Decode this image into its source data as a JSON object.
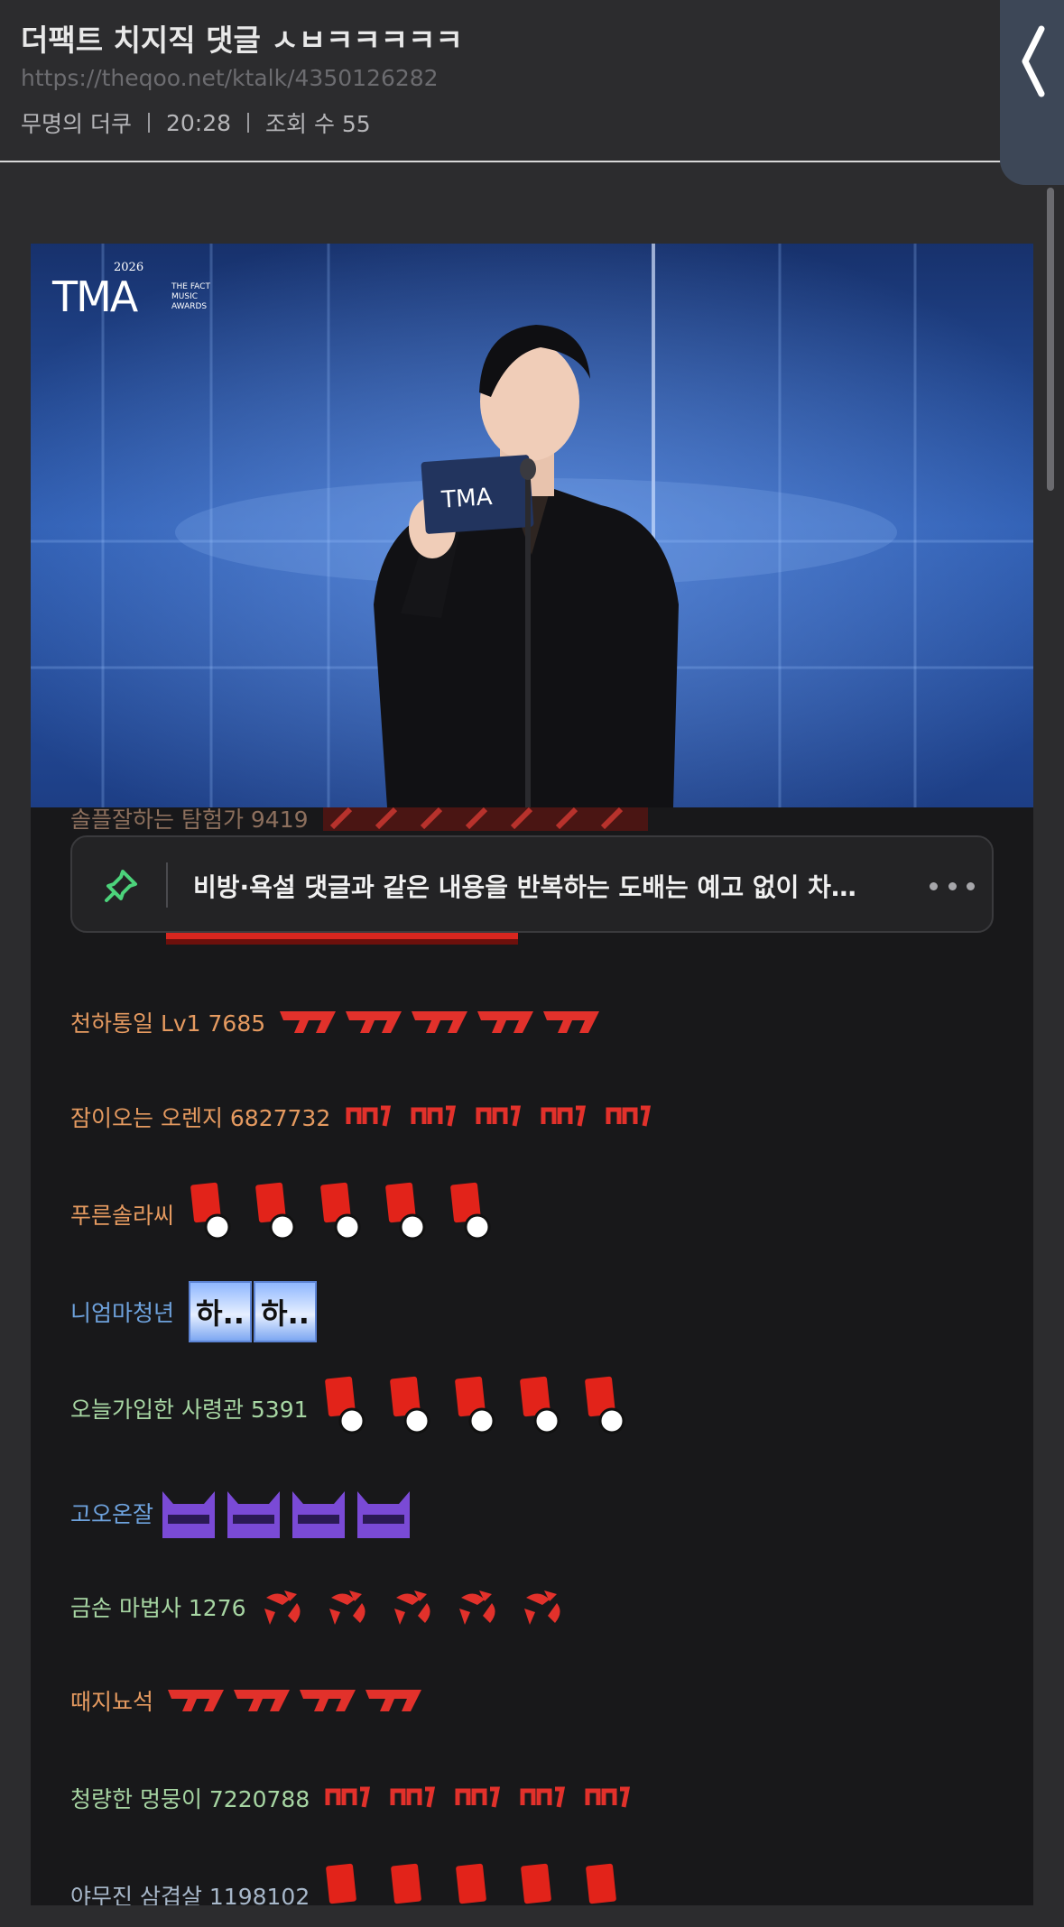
{
  "post": {
    "title": "더팩트 치지직 댓글 ㅅㅂㅋㅋㅋㅋㅋ",
    "url": "https://theqoo.net/ktalk/4350126282",
    "author": "무명의 더쿠",
    "time": "20:28",
    "views": "조회 수 55"
  },
  "video": {
    "logo_year": "2026",
    "logo_text": "TMA",
    "logo_sub1": "THE FACT",
    "logo_sub2": "MUSIC",
    "logo_sub3": "AWARDS",
    "card_text": "TMA"
  },
  "pinned": {
    "text": "비방·욕설 댓글과 같은 내용을 반복하는 도배는 예고 없이 차…",
    "icon": "pin-icon",
    "more_icon": "more-icon"
  },
  "comments": [
    {
      "name": "솔플잘하는 탐험가 9419",
      "emote": "red-sign",
      "count": 5
    },
    {
      "name": "천하통일 Lv1 7685",
      "emote": "red-slash",
      "count": 5
    },
    {
      "name": "잠이오는 오렌지 6827732",
      "emote": "red-nn",
      "count": 5
    },
    {
      "name": "푸른솔라씨",
      "emote": "red-card",
      "count": 5
    },
    {
      "name": "니엄마청년",
      "emote": "ha",
      "count": 2,
      "emote_text": "하.."
    },
    {
      "name": "오늘가입한 사령관 5391",
      "emote": "red-card",
      "count": 5
    },
    {
      "name": "고오온잘",
      "emote": "purple-cat",
      "count": 4
    },
    {
      "name": "금손 마법사 1276",
      "emote": "anger",
      "count": 5
    },
    {
      "name": "때지뇨석",
      "emote": "red-slash",
      "count": 4
    },
    {
      "name": "청량한 멍뭉이 7220788",
      "emote": "red-nn",
      "count": 5
    },
    {
      "name": "야무진 삼겹살 1198102",
      "emote": "red-card",
      "count": 5
    }
  ],
  "colors": {
    "background": "#2c2c2e",
    "chat_background": "#18181a",
    "name_orange": "#e59a60",
    "name_blue": "#6ea2dd",
    "name_green": "#a7d6a3",
    "pin_green": "#4cd37b",
    "emote_red": "#e53935"
  }
}
